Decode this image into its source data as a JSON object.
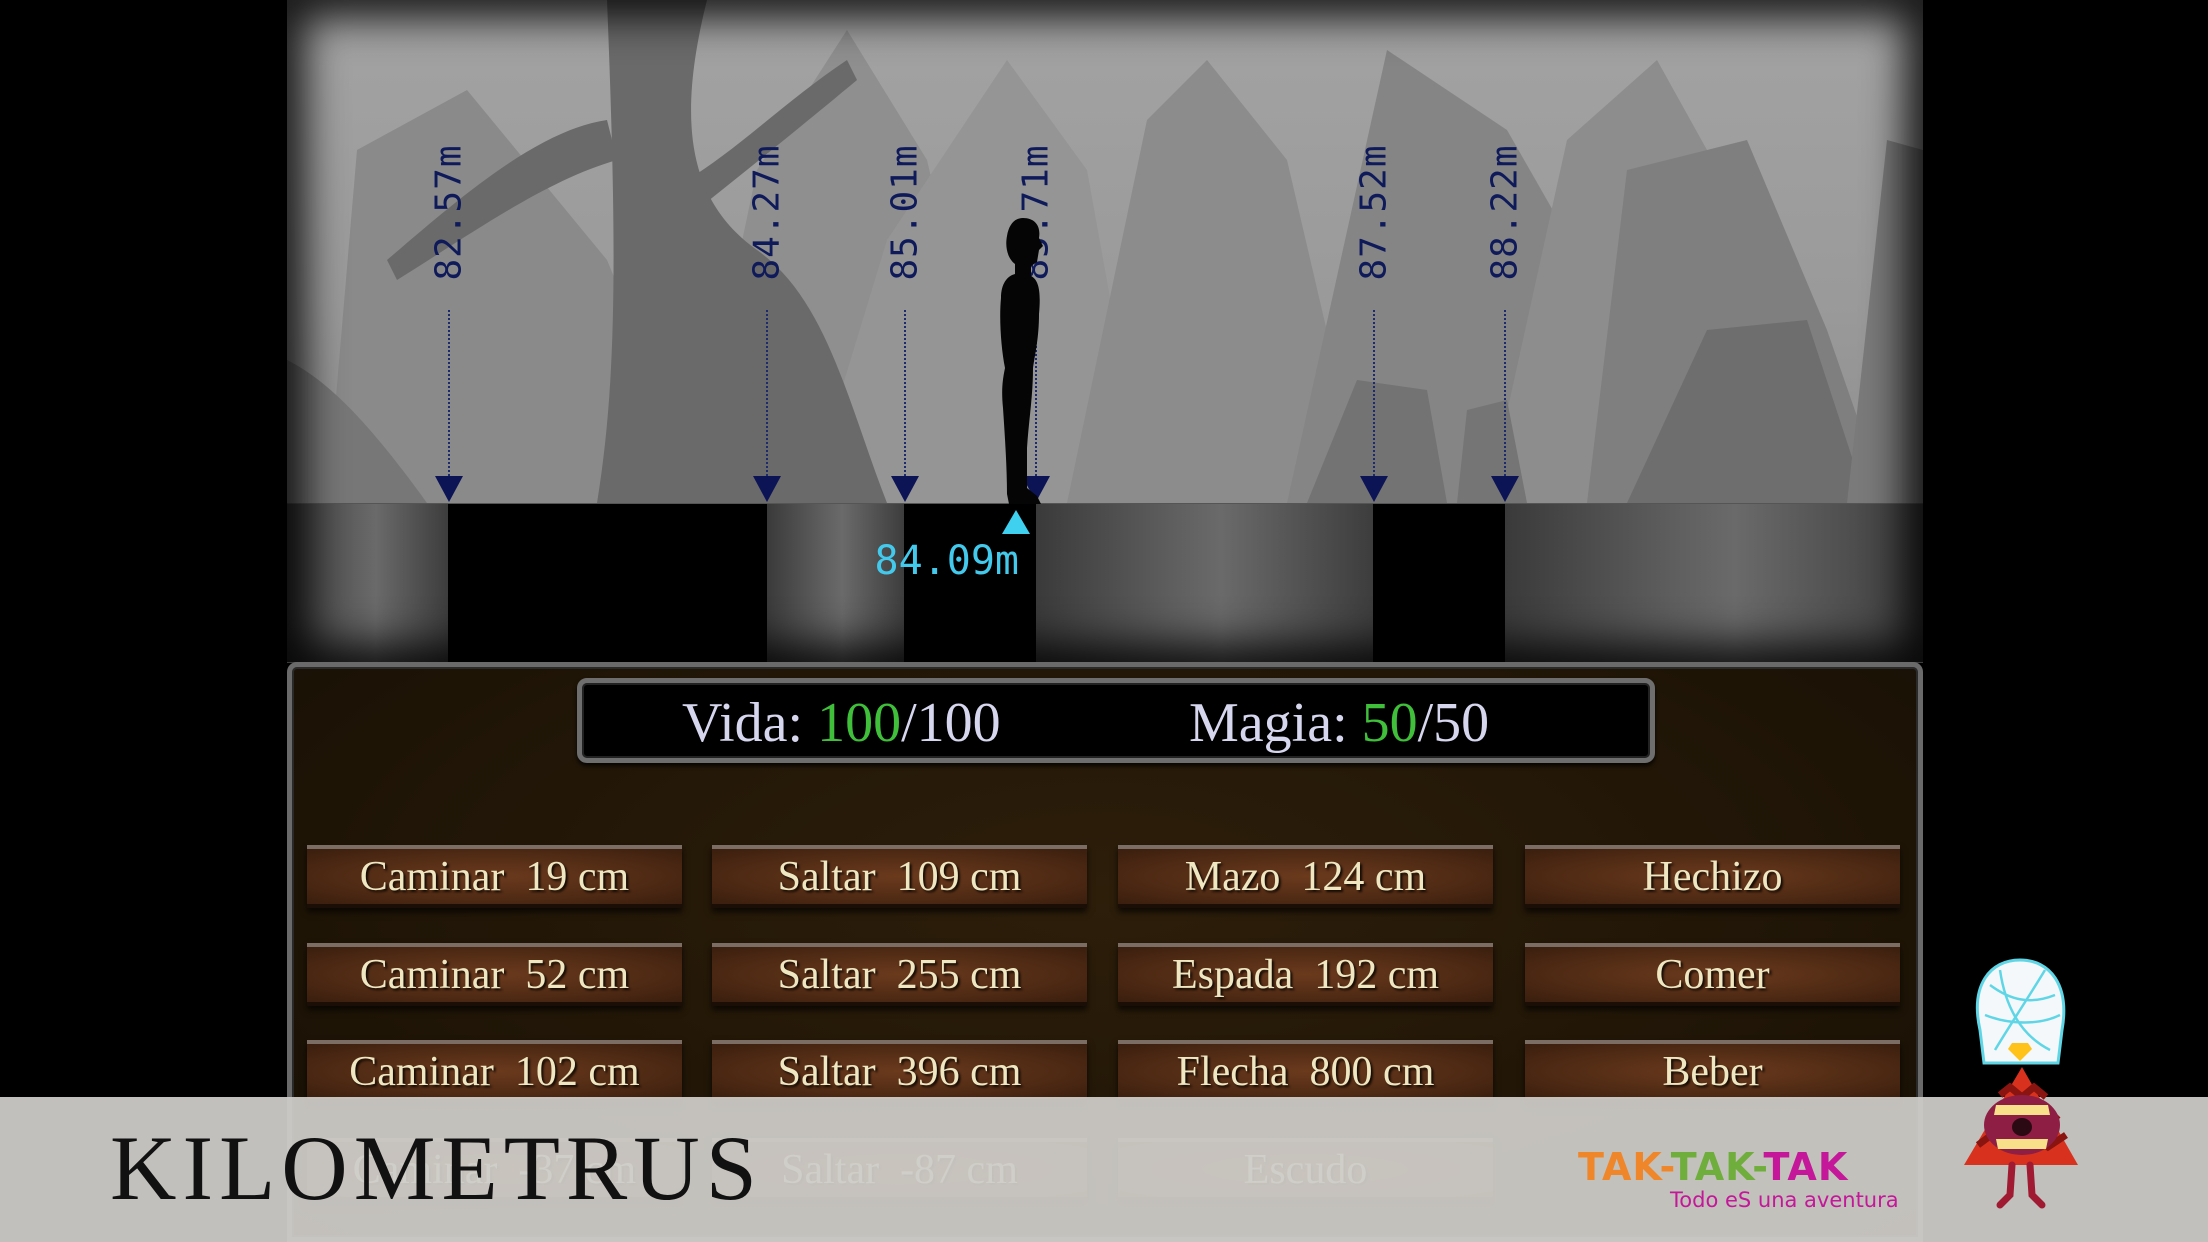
{
  "scene": {
    "markers": [
      {
        "label": "82.57m",
        "value_m": 82.57
      },
      {
        "label": "84.27m",
        "value_m": 84.27
      },
      {
        "label": "85.01m",
        "value_m": 85.01
      },
      {
        "label": "85.71m",
        "value_m": 85.71
      },
      {
        "label": "87.52m",
        "value_m": 87.52
      },
      {
        "label": "88.22m",
        "value_m": 88.22
      }
    ],
    "player_position": "84.09m",
    "colors": {
      "marker": "#0f1a5a",
      "player_marker": "#43c9ec"
    }
  },
  "stats": {
    "vida_label": "Vida: ",
    "vida_current": "100",
    "vida_max": "/100",
    "magia_label": "Magia: ",
    "magia_current": "50",
    "magia_max": "/50",
    "colors": {
      "current": "#3fbf3a",
      "text": "#d6d6ee"
    }
  },
  "actions": [
    [
      "Caminar  19 cm",
      "Saltar  109 cm",
      "Mazo  124 cm",
      "Hechizo"
    ],
    [
      "Caminar  52 cm",
      "Saltar  255 cm",
      "Espada  192 cm",
      "Comer"
    ],
    [
      "Caminar  102 cm",
      "Saltar  396 cm",
      "Flecha  800 cm",
      "Beber"
    ],
    [
      "Caminar  -37 cm",
      "Saltar  -87 cm",
      "Escudo",
      ""
    ]
  ],
  "overlay": {
    "title": "KILOMETRUS",
    "logo": {
      "parts": [
        {
          "text": "TAK-",
          "color": "#f0862a"
        },
        {
          "text": "TAK-",
          "color": "#6fae3c"
        },
        {
          "text": "TAK",
          "color": "#c4179a"
        }
      ],
      "tagline": "Todo eS una aventura"
    },
    "mascot_icon": "turban-triangle-mascot-icon"
  }
}
